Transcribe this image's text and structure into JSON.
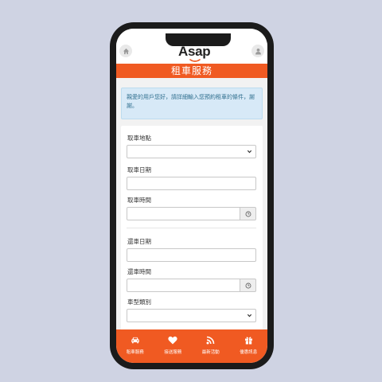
{
  "app": {
    "logo_text": "Asap",
    "page_title": "租車服務"
  },
  "colors": {
    "brand": "#f05a22",
    "notice_bg": "#d7e9f7",
    "notice_text": "#31708f"
  },
  "header": {
    "home_icon": "home-icon",
    "user_icon": "user-icon"
  },
  "notice": {
    "text": "親愛的用戶您好，請詳細輸入您預約租車的條件，謝謝。"
  },
  "form": {
    "pickup_location_label": "取車地點",
    "pickup_date_label": "取車日期",
    "pickup_time_label": "取車時間",
    "return_date_label": "還車日期",
    "return_time_label": "還車時間",
    "car_type_label": "車型類別"
  },
  "bottom_nav": {
    "items": [
      {
        "label": "租車服務",
        "icon": "car-icon"
      },
      {
        "label": "接送服務",
        "icon": "heart-icon"
      },
      {
        "label": "最新活動",
        "icon": "rss-icon"
      },
      {
        "label": "優惠訊息",
        "icon": "gift-icon"
      }
    ]
  }
}
